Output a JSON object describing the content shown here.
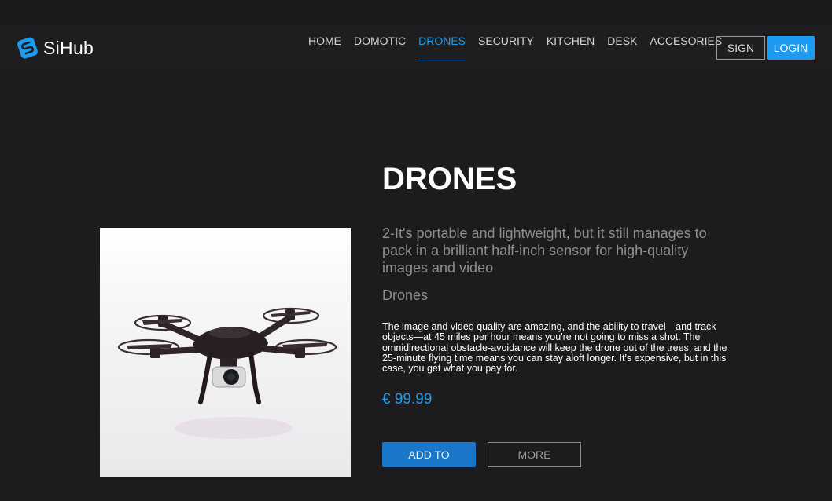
{
  "brand": {
    "name": "SiHub",
    "color": "#1d9bf0"
  },
  "nav": {
    "items": [
      {
        "label": "HOME",
        "active": false
      },
      {
        "label": "DOMOTIC",
        "active": false
      },
      {
        "label": "DRONES",
        "active": true
      },
      {
        "label": "SECURITY",
        "active": false
      },
      {
        "label": "KITCHEN",
        "active": false
      },
      {
        "label": "DESK",
        "active": false
      },
      {
        "label": "ACCESORIES",
        "active": false
      }
    ],
    "sign_label": "SIGN",
    "login_label": "LOGIN"
  },
  "product": {
    "title": "DRONES",
    "subtitle": "2-It's portable and lightweight, but it still manages to pack in a brilliant half-inch sensor for high-quality images and video",
    "category": "Drones",
    "description": "The image and video quality are amazing, and the ability to travel—and track objects—at 45 miles per hour means you're not going to miss a shot. The omnidirectional obstacle-avoidance will keep the drone out of the trees, and the 25-minute flying time means you can stay aloft longer. It's expensive, but in this case, you get what you pay for.",
    "price": "€ 99.99",
    "add_label": "ADD TO",
    "more_label": "MORE"
  },
  "colors": {
    "accent": "#1f9cf0",
    "background": "#1c1c1e",
    "muted_text": "#8e8e8e"
  }
}
